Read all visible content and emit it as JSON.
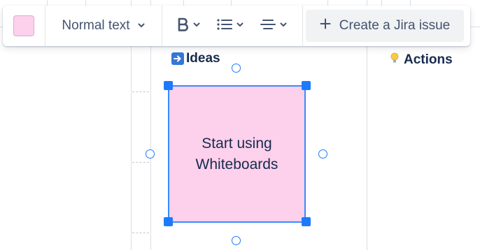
{
  "toolbar": {
    "color_swatch": "#fdd0ec",
    "text_style": "Normal text",
    "bold_icon": "bold-icon",
    "list_icon": "bulleted-list-icon",
    "align_icon": "align-center-icon",
    "create_issue_label": "Create a Jira issue"
  },
  "canvas": {
    "sections": [
      {
        "emoji": "arrow-right-emoji",
        "title": "Ideas"
      },
      {
        "emoji": "lightbulb-emoji",
        "title": "Actions"
      }
    ],
    "sticky": {
      "text": "Start using Whiteboards",
      "color": "#fdd0ec",
      "border_color": "#388bff"
    }
  },
  "colors": {
    "selection": "#1d7afc",
    "text": "#172b4d",
    "subtle_text": "#44546f"
  }
}
